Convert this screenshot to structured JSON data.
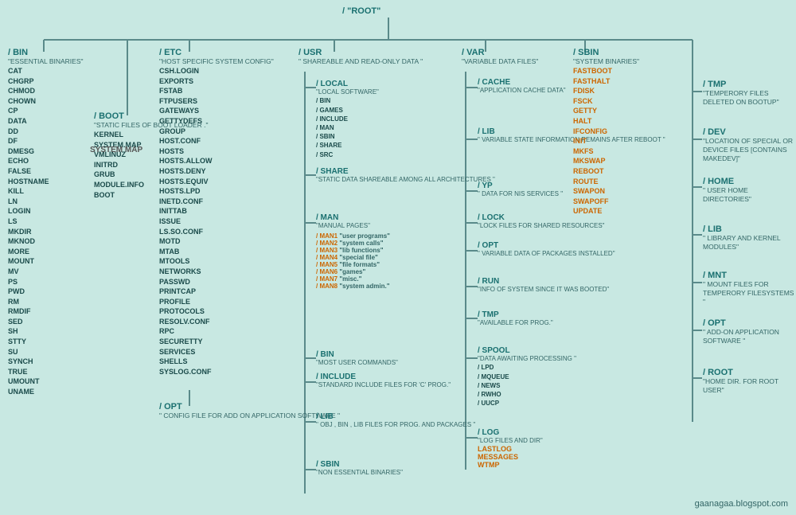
{
  "root": {
    "label": "/   \"ROOT\""
  },
  "bin": {
    "title": "/ BIN",
    "desc": "\"ESSENTIAL BINARIES\"",
    "items": [
      "CAT",
      "CHGRP",
      "CHMOD",
      "CHOWN",
      "CP",
      "DATA",
      "DD",
      "DF",
      "DMESG",
      "ECHO",
      "FALSE",
      "HOSTNAME",
      "KILL",
      "LN",
      "LOGIN",
      "LS",
      "MKDIR",
      "MKNOD",
      "MORE",
      "MOUNT",
      "MV",
      "PS",
      "PWD",
      "RM",
      "RMDIF",
      "SED",
      "SH",
      "STTY",
      "SU",
      "SYNCH",
      "TRUE",
      "UMOUNT",
      "UNAME"
    ]
  },
  "boot": {
    "title": "/ BOOT",
    "desc": "\"STATIC FILES OF BOOT LOADER .\"",
    "items": [
      "KERNEL",
      "SYSTEM.MAP",
      "VMLINUZ",
      "INITRD",
      "GRUB",
      "MODULE.INFO",
      "BOOT"
    ]
  },
  "etc": {
    "title": "/ ETC",
    "desc": "\"HOST SPECIFIC SYSTEM CONFIG\"",
    "items": [
      "CSH.LOGIN",
      "EXPORTS",
      "FSTAB",
      "FTPUSERS",
      "GATEWAYS",
      "GETTYDEFS",
      "GROUP",
      "HOST.CONF",
      "HOSTS",
      "HOSTS.ALLOW",
      "HOSTS.DENY",
      "HOSTS.EQUIV",
      "HOSTS.LPD",
      "INETD.CONF",
      "INITTAB",
      "ISSUE",
      "LS.SO.CONF",
      "MOTD",
      "MTAB",
      "MTOOLS",
      "NETWORKS",
      "PASSWD",
      "PRINTCAP",
      "PROFILE",
      "PROTOCOLS",
      "RESOLV.CONF",
      "RPC",
      "SECURETTY",
      "SERVICES",
      "SHELLS",
      "SYSLOG.CONF"
    ]
  },
  "etc_opt": {
    "title": "/ OPT",
    "desc": "\" CONFIG FILE FOR ADD ON APPLICATION SOFTWARE \""
  },
  "usr": {
    "title": "/ USR",
    "desc": "\" SHAREABLE AND READ-ONLY DATA \""
  },
  "usr_local": {
    "title": "/ LOCAL",
    "desc": "\"LOCAL SOFTWARE\"",
    "subitems": [
      "/ BIN",
      "/ GAMES",
      "/ INCLUDE",
      "/ MAN",
      "/ SBIN",
      "/ SHARE",
      "/ SRC"
    ]
  },
  "usr_share": {
    "title": "/ SHARE",
    "desc": "\"STATIC DATA SHAREABLE AMONG ALL ARCHITECTURES \""
  },
  "usr_man": {
    "title": "/ MAN",
    "desc": "\"MANUAL PAGES\"",
    "subitems": [
      {
        "label": "/ MAN1",
        "desc": "\"user programs\""
      },
      {
        "label": "/ MAN2",
        "desc": "\"system calls\""
      },
      {
        "label": "/ MAN3",
        "desc": "\"lib functions\""
      },
      {
        "label": "/ MAN4",
        "desc": "\"special file\""
      },
      {
        "label": "/ MAN5",
        "desc": "\"file formats\""
      },
      {
        "label": "/ MAN6",
        "desc": "\"games\""
      },
      {
        "label": "/ MAN7",
        "desc": "\"misc.\""
      },
      {
        "label": "/ MAN8",
        "desc": "\"system admin.\""
      }
    ]
  },
  "usr_bin": {
    "title": "/ BIN",
    "desc": "\"MOST USER COMMANDS\""
  },
  "usr_include": {
    "title": "/ INCLUDE",
    "desc": "\"STANDARD INCLUDE FILES FOR 'C' PROG.\""
  },
  "usr_lib": {
    "title": "/ LIB",
    "desc": "\" OBJ , BIN , LIB FILES FOR PROG. AND PACKAGES \""
  },
  "usr_sbin": {
    "title": "/ SBIN",
    "desc": "\"NON ESSENTIAL BINARIES\""
  },
  "var": {
    "title": "/ VAR",
    "desc": "\"VARIABLE DATA FILES\""
  },
  "var_cache": {
    "title": "/ CACHE",
    "desc": "\"APPLICATION CACHE DATA\""
  },
  "var_lib": {
    "title": "/ LIB",
    "desc": "\" VARIABLE STATE INFORMATION REMAINS AFTER REBOOT \""
  },
  "var_yp": {
    "title": "/ YP",
    "desc": "\" DATA FOR NIS SERVICES \""
  },
  "var_lock": {
    "title": "/ LOCK",
    "desc": "\"LOCK FILES FOR SHARED RESOURCES\""
  },
  "var_opt": {
    "title": "/ OPT",
    "desc": "\" VARIABLE DATA OF PACKAGES INSTALLED\""
  },
  "var_run": {
    "title": "/ RUN",
    "desc": "\"INFO OF SYSTEM SINCE IT WAS BOOTED\""
  },
  "var_tmp": {
    "title": "/ TMP",
    "desc": "\"AVAILABLE FOR PROG.\""
  },
  "var_spool": {
    "title": "/ SPOOL",
    "desc": "\"DATA AWAITING PROCESSING \"",
    "subitems": [
      "/ LPD",
      "/ MQUEUE",
      "/ NEWS",
      "/ RWHO",
      "/ UUCP"
    ]
  },
  "var_log": {
    "title": "/ LOG",
    "desc": "\"LOG FILES AND DIR\"",
    "items_orange": [
      "LASTLOG",
      "MESSAGES",
      "WTMP"
    ]
  },
  "sbin": {
    "title": "/ SBIN",
    "desc": "\"SYSTEM BINARIES\"",
    "items_orange": [
      "FASTBOOT",
      "FASTHALT",
      "FDISK",
      "FSCK",
      "GETTY",
      "HALT",
      "IFCONFIG",
      "INIT",
      "MKFS",
      "MKSWAP",
      "REBOOT",
      "ROUTE",
      "SWAPON",
      "SWAPOFF",
      "UPDATE"
    ]
  },
  "tmp": {
    "title": "/ TMP",
    "desc": "\"TEMPERORY FILES DELETED ON BOOTUP\""
  },
  "dev": {
    "title": "/ DEV",
    "desc": "\"LOCATION OF SPECIAL OR DEVICE FILES [CONTAINS MAKEDEV]\""
  },
  "home": {
    "title": "/ HOME",
    "desc": "\" USER HOME DIRECTORIES\""
  },
  "lib": {
    "title": "/ LIB",
    "desc": "\"  LIBRARY AND KERNEL MODULES\""
  },
  "mnt": {
    "title": "/ MNT",
    "desc": "\"  MOUNT FILES FOR TEMPERORY FILESYSTEMS \""
  },
  "opt": {
    "title": "/ OPT",
    "desc": "\" ADD-ON APPLICATION SOFTWARE \""
  },
  "root_home": {
    "title": "/ ROOT",
    "desc": "\"HOME DIR. FOR ROOT USER\""
  },
  "watermark": "gaanagaa.blogspot.com",
  "system_map": "SYSTEM MAP"
}
